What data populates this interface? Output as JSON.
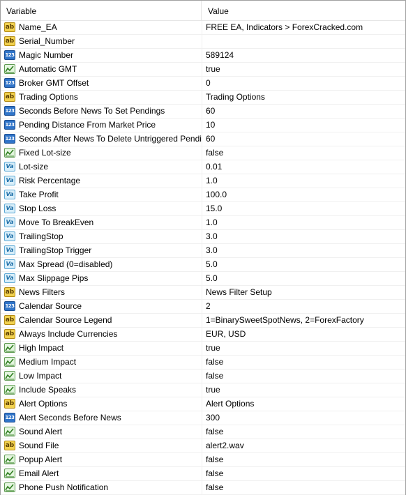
{
  "header": {
    "variable": "Variable",
    "value": "Value"
  },
  "icon_types": {
    "ab": "string-type-icon",
    "n123": "integer-type-icon",
    "va": "double-type-icon",
    "bool": "boolean-type-icon"
  },
  "rows": [
    {
      "type": "ab",
      "name": "Name_EA",
      "value": "FREE EA, Indicators > ForexCracked.com"
    },
    {
      "type": "ab",
      "name": "Serial_Number",
      "value": ""
    },
    {
      "type": "n123",
      "name": "Magic Number",
      "value": "589124"
    },
    {
      "type": "bool",
      "name": "Automatic GMT",
      "value": "true"
    },
    {
      "type": "n123",
      "name": "Broker GMT Offset",
      "value": "0"
    },
    {
      "type": "ab",
      "name": "Trading Options",
      "value": "Trading Options"
    },
    {
      "type": "n123",
      "name": "Seconds Before News To Set Pendings",
      "value": "60"
    },
    {
      "type": "n123",
      "name": "Pending Distance From Market Price",
      "value": "10"
    },
    {
      "type": "n123",
      "name": "Seconds After News To Delete Untriggered Pendings",
      "value": "60"
    },
    {
      "type": "bool",
      "name": "Fixed Lot-size",
      "value": "false"
    },
    {
      "type": "va",
      "name": "Lot-size",
      "value": "0.01"
    },
    {
      "type": "va",
      "name": "Risk Percentage",
      "value": "1.0"
    },
    {
      "type": "va",
      "name": "Take Profit",
      "value": "100.0"
    },
    {
      "type": "va",
      "name": "Stop Loss",
      "value": "15.0"
    },
    {
      "type": "va",
      "name": "Move To BreakEven",
      "value": "1.0"
    },
    {
      "type": "va",
      "name": "TrailingStop",
      "value": "3.0"
    },
    {
      "type": "va",
      "name": "TrailingStop Trigger",
      "value": "3.0"
    },
    {
      "type": "va",
      "name": "Max Spread (0=disabled)",
      "value": "5.0"
    },
    {
      "type": "va",
      "name": "Max Slippage Pips",
      "value": "5.0"
    },
    {
      "type": "ab",
      "name": "News Filters",
      "value": "News Filter Setup"
    },
    {
      "type": "n123",
      "name": "Calendar Source",
      "value": "2"
    },
    {
      "type": "ab",
      "name": "Calendar Source Legend",
      "value": "1=BinarySweetSpotNews, 2=ForexFactory"
    },
    {
      "type": "ab",
      "name": "Always Include Currencies",
      "value": "EUR, USD"
    },
    {
      "type": "bool",
      "name": "High Impact",
      "value": "true"
    },
    {
      "type": "bool",
      "name": "Medium Impact",
      "value": "false"
    },
    {
      "type": "bool",
      "name": "Low Impact",
      "value": "false"
    },
    {
      "type": "bool",
      "name": "Include Speaks",
      "value": "true"
    },
    {
      "type": "ab",
      "name": "Alert Options",
      "value": "Alert Options"
    },
    {
      "type": "n123",
      "name": "Alert Seconds Before News",
      "value": "300"
    },
    {
      "type": "bool",
      "name": "Sound Alert",
      "value": "false"
    },
    {
      "type": "ab",
      "name": "Sound File",
      "value": "alert2.wav"
    },
    {
      "type": "bool",
      "name": "Popup Alert",
      "value": "false"
    },
    {
      "type": "bool",
      "name": "Email Alert",
      "value": "false"
    },
    {
      "type": "bool",
      "name": "Phone Push Notification",
      "value": "false"
    }
  ]
}
